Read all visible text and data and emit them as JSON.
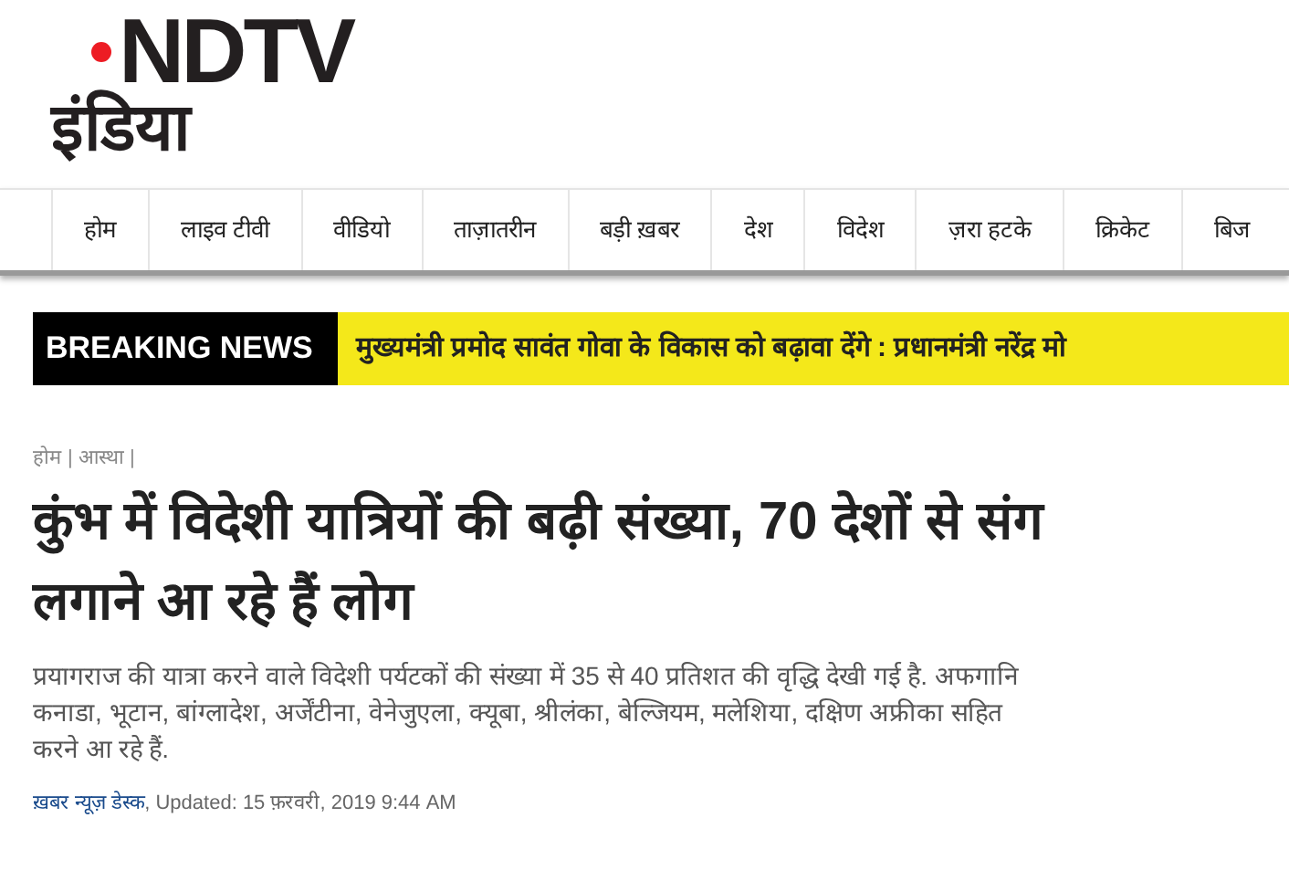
{
  "logo": {
    "latin": "NDTV",
    "hindi": "इंडिया"
  },
  "nav": [
    {
      "label": "होम"
    },
    {
      "label": "लाइव टीवी"
    },
    {
      "label": "वीडियो"
    },
    {
      "label": "ताज़ातरीन"
    },
    {
      "label": "बड़ी ख़बर"
    },
    {
      "label": "देश"
    },
    {
      "label": "विदेश"
    },
    {
      "label": "ज़रा हटके"
    },
    {
      "label": "क्रिकेट"
    },
    {
      "label": "बिज"
    }
  ],
  "breaking": {
    "label": "BREAKING NEWS",
    "text": "मुख्यमंत्री प्रमोद सावंत गोवा के विकास को बढ़ावा देंगे : प्रधानमंत्री नरेंद्र मो"
  },
  "breadcrumb": [
    "होम |",
    "आस्था |"
  ],
  "headline": [
    "कुंभ में विदेशी यात्रियों की बढ़ी संख्या, 70 देशों से संग",
    "लगाने आ रहे हैं लोग"
  ],
  "summary": [
    "प्रयागराज की यात्रा करने वाले विदेशी पर्यटकों की संख्या में 35 से 40 प्रतिशत की वृद्धि देखी गई है. अफगानि",
    "कनाडा, भूटान, बांग्लादेश, अर्जेंटीना, वेनेजुएला, क्यूबा, श्रीलंका, बेल्जियम, मलेशिया, दक्षिण अफ्रीका सहित",
    "करने आ रहे हैं."
  ],
  "byline": {
    "author": "ख़बर न्यूज़ डेस्क",
    "updated": ", Updated: 15 फ़रवरी, 2019 9:44 AM"
  }
}
